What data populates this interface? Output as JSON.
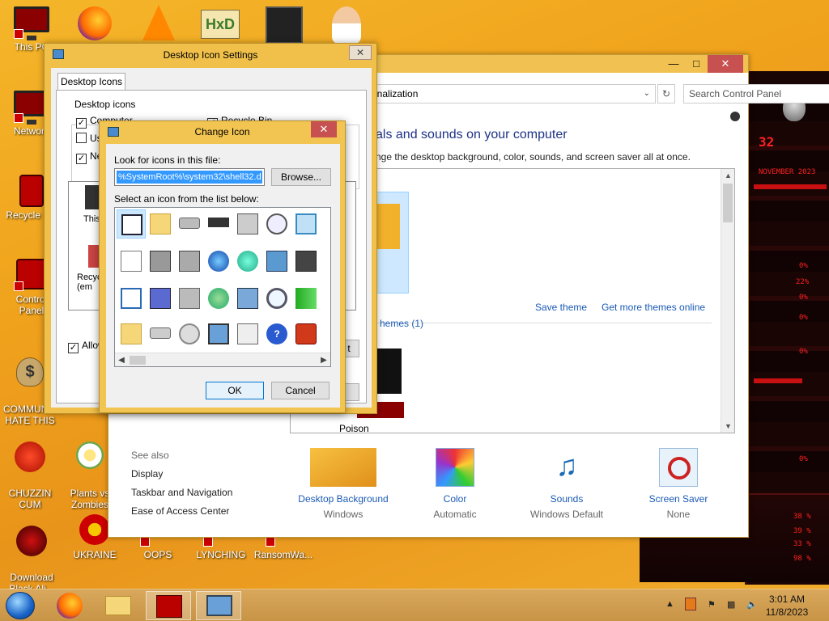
{
  "desktop": {
    "icons": [
      {
        "label": "This PC"
      },
      {
        "label": "Network"
      },
      {
        "label": "Recycle Bin"
      },
      {
        "label": "Control Panel"
      },
      {
        "label": "COMMUNISM\nHATE THIS"
      },
      {
        "label": "CHUZZIN\nCUM"
      },
      {
        "label": "Plants vs\nZombies"
      },
      {
        "label": "Download\nBlack Ali..."
      },
      {
        "label": "UKRAINE"
      },
      {
        "label": "OOPS"
      },
      {
        "label": "LYNCHING"
      },
      {
        "label": "RansomWa..."
      }
    ]
  },
  "sci_panel": {
    "header_text": "32",
    "date_text": "NOVEMBER 2023",
    "readouts": [
      "0%",
      "22%",
      "0%",
      "0%",
      "0%",
      "0%",
      "38 %",
      "39 %",
      "33 %",
      "98 %"
    ]
  },
  "control_panel": {
    "address": "onalization",
    "search_placeholder": "Search Control Panel",
    "heading": "als and sounds on your computer",
    "subheading": "nge the desktop background, color, sounds, and screen saver all at once.",
    "save_theme": "Save theme",
    "get_more_themes": "Get more themes online",
    "installed_themes": "hemes (1)",
    "poison_label": "Poison",
    "see_also": "See also",
    "see_also_links": [
      "Display",
      "Taskbar and Navigation",
      "Ease of Access Center"
    ],
    "bottom_items": [
      {
        "label": "Desktop Background",
        "value": "Windows",
        "color": "#f2a51a"
      },
      {
        "label": "Color",
        "value": "Automatic",
        "color": "#4a90d9"
      },
      {
        "label": "Sounds",
        "value": "Windows Default",
        "color": "#1a6ab5"
      },
      {
        "label": "Screen Saver",
        "value": "None",
        "color": "#cc2222"
      }
    ]
  },
  "desktop_icon_settings": {
    "title": "Desktop Icon Settings",
    "tab": "Desktop Icons",
    "group_label": "Desktop icons",
    "checkboxes": [
      {
        "label": "Computer",
        "checked": true
      },
      {
        "label": "Use",
        "checked": false
      },
      {
        "label": "Ne",
        "checked": true
      },
      {
        "label": "Recycle Bin",
        "checked": true
      }
    ],
    "list_items": [
      "This",
      "Recyc\n(em"
    ],
    "allow_label": "Allow",
    "apply_fragment": "t"
  },
  "change_icon": {
    "title": "Change Icon",
    "look_label": "Look for icons in this file:",
    "file_path": "%SystemRoot%\\system32\\shell32.d",
    "browse": "Browse...",
    "select_label": "Select an icon from the list below:",
    "ok": "OK",
    "cancel": "Cancel"
  },
  "taskbar": {
    "clock_time": "3:01 AM",
    "clock_date": "11/8/2023"
  },
  "colors": {
    "accent_blue": "#1a5ab5",
    "title_gold": "#f1c251",
    "close_red": "#c75050"
  }
}
